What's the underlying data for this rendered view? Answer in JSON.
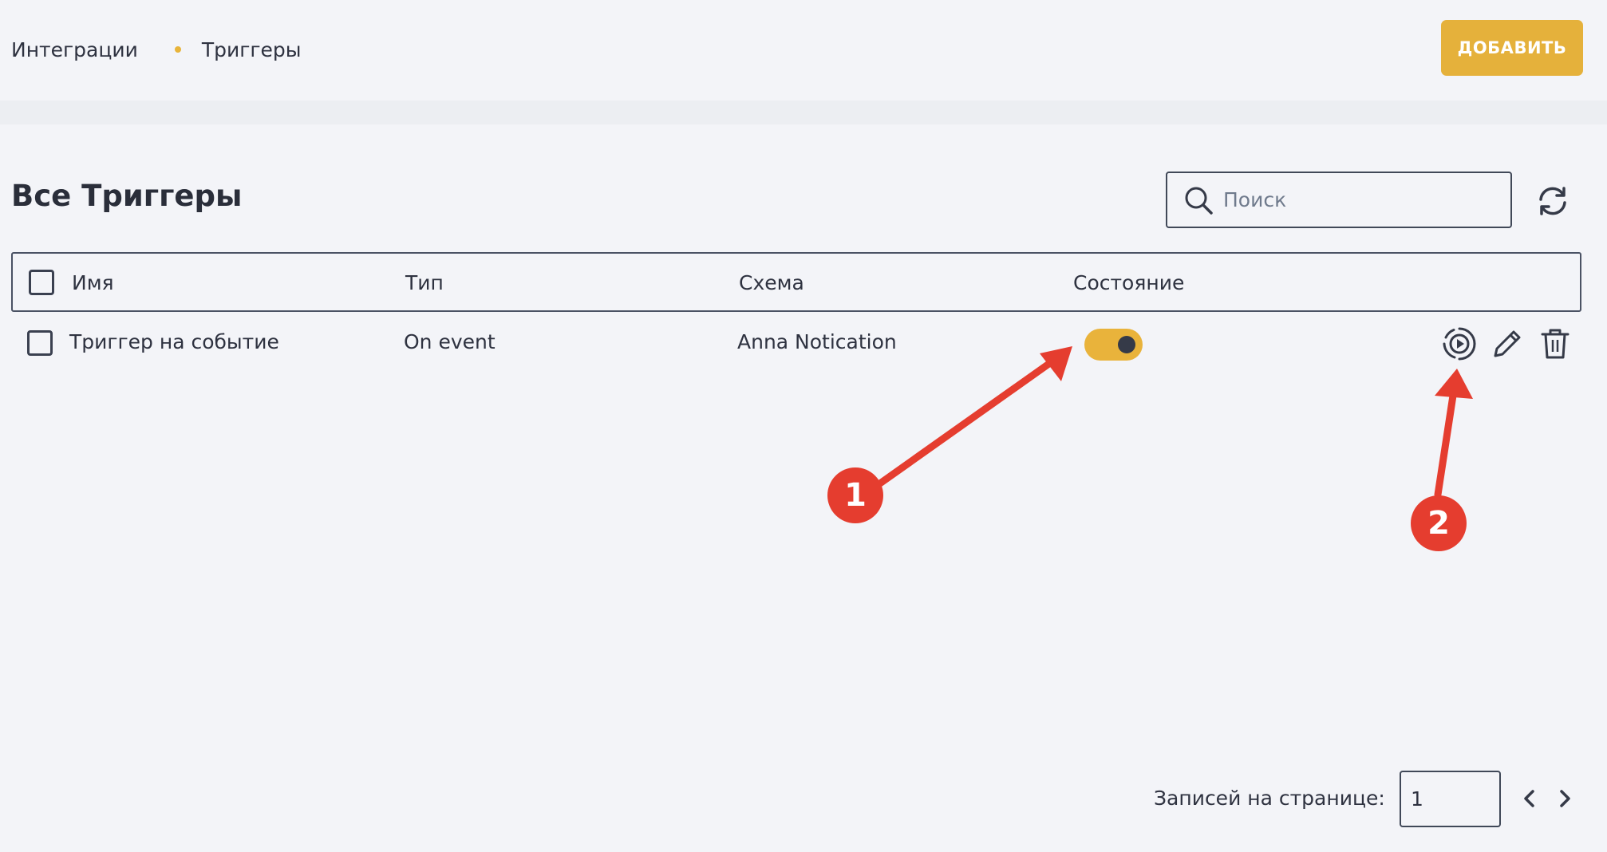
{
  "breadcrumb": {
    "items": [
      "Интеграции",
      "Триггеры"
    ]
  },
  "header": {
    "add_button": "ДОБАВИТЬ"
  },
  "page": {
    "title": "Все Триггеры"
  },
  "search": {
    "placeholder": "Поиск",
    "value": ""
  },
  "table": {
    "columns": [
      "Имя",
      "Тип",
      "Схема",
      "Состояние"
    ],
    "rows": [
      {
        "name": "Триггер на событие",
        "type": "On event",
        "scheme": "Anna Notication",
        "enabled": true
      }
    ]
  },
  "annotations": [
    "1",
    "2"
  ],
  "pagination": {
    "label": "Записей на странице:",
    "value": "1"
  },
  "colors": {
    "accent": "#e5b13b",
    "annotation": "#e53d2f",
    "text": "#2e3240",
    "background": "#f3f4f8"
  }
}
